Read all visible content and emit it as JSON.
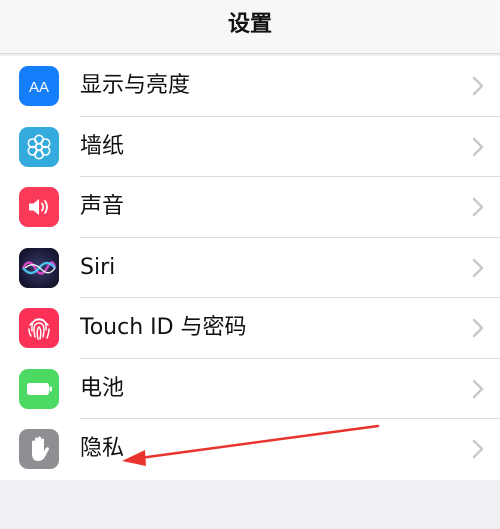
{
  "nav": {
    "title": "设置"
  },
  "items": [
    {
      "label": "显示与亮度",
      "icon": "display-brightness-icon",
      "color": "#147efb"
    },
    {
      "label": "墙纸",
      "icon": "wallpaper-flower-icon",
      "color": "#35aadc"
    },
    {
      "label": "声音",
      "icon": "speaker-icon",
      "color": "#fb3a5a"
    },
    {
      "label": "Siri",
      "icon": "siri-icon",
      "color": "#1c1c3a"
    },
    {
      "label": "Touch ID 与密码",
      "icon": "fingerprint-icon",
      "color": "#fc3158"
    },
    {
      "label": "电池",
      "icon": "battery-icon",
      "color": "#4cd964"
    },
    {
      "label": "隐私",
      "icon": "hand-privacy-icon",
      "color": "#8e8e93"
    }
  ],
  "annotation": {
    "color": "#e8332e"
  },
  "icons": {
    "display_text": "AA"
  }
}
